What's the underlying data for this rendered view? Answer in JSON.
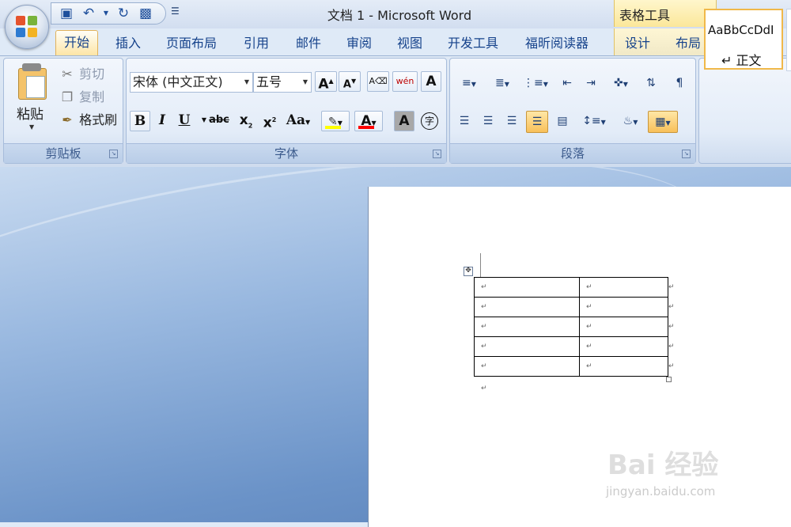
{
  "window": {
    "title": "文档 1 - Microsoft Word"
  },
  "quick_access": {
    "save": "save-icon",
    "undo": "undo-icon",
    "redo": "redo-icon",
    "print_preview": "print-preview-icon",
    "customize": "customize-icon"
  },
  "contextual": {
    "title": "表格工具",
    "tabs": [
      "设计",
      "布局"
    ]
  },
  "tabs": [
    "开始",
    "插入",
    "页面布局",
    "引用",
    "邮件",
    "审阅",
    "视图",
    "开发工具",
    "福昕阅读器"
  ],
  "clipboard": {
    "paste": "粘贴",
    "cut": "剪切",
    "copy": "复制",
    "format_painter": "格式刷",
    "label": "剪贴板"
  },
  "font": {
    "name": "宋体 (中文正文)",
    "size": "五号",
    "label": "字体",
    "grow": "A",
    "shrink": "A",
    "pinyin": "wén",
    "border_char": "A",
    "bold": "B",
    "italic": "I",
    "underline": "U",
    "strike": "abc",
    "subscript": "x",
    "superscript": "x",
    "case": "Aa",
    "color": "A",
    "shade": "A",
    "enclose": "字",
    "highlight_color": "#ffff00",
    "font_color": "#ff0000"
  },
  "paragraph": {
    "label": "段落"
  },
  "styles": {
    "sample": "AaBbCcDdI",
    "normal": "↵ 正文"
  },
  "document": {
    "cell_mark": "↵",
    "rows": 5,
    "cols": 2
  },
  "watermark": {
    "brand": "Bai 经验",
    "url": "jingyan.baidu.com"
  }
}
